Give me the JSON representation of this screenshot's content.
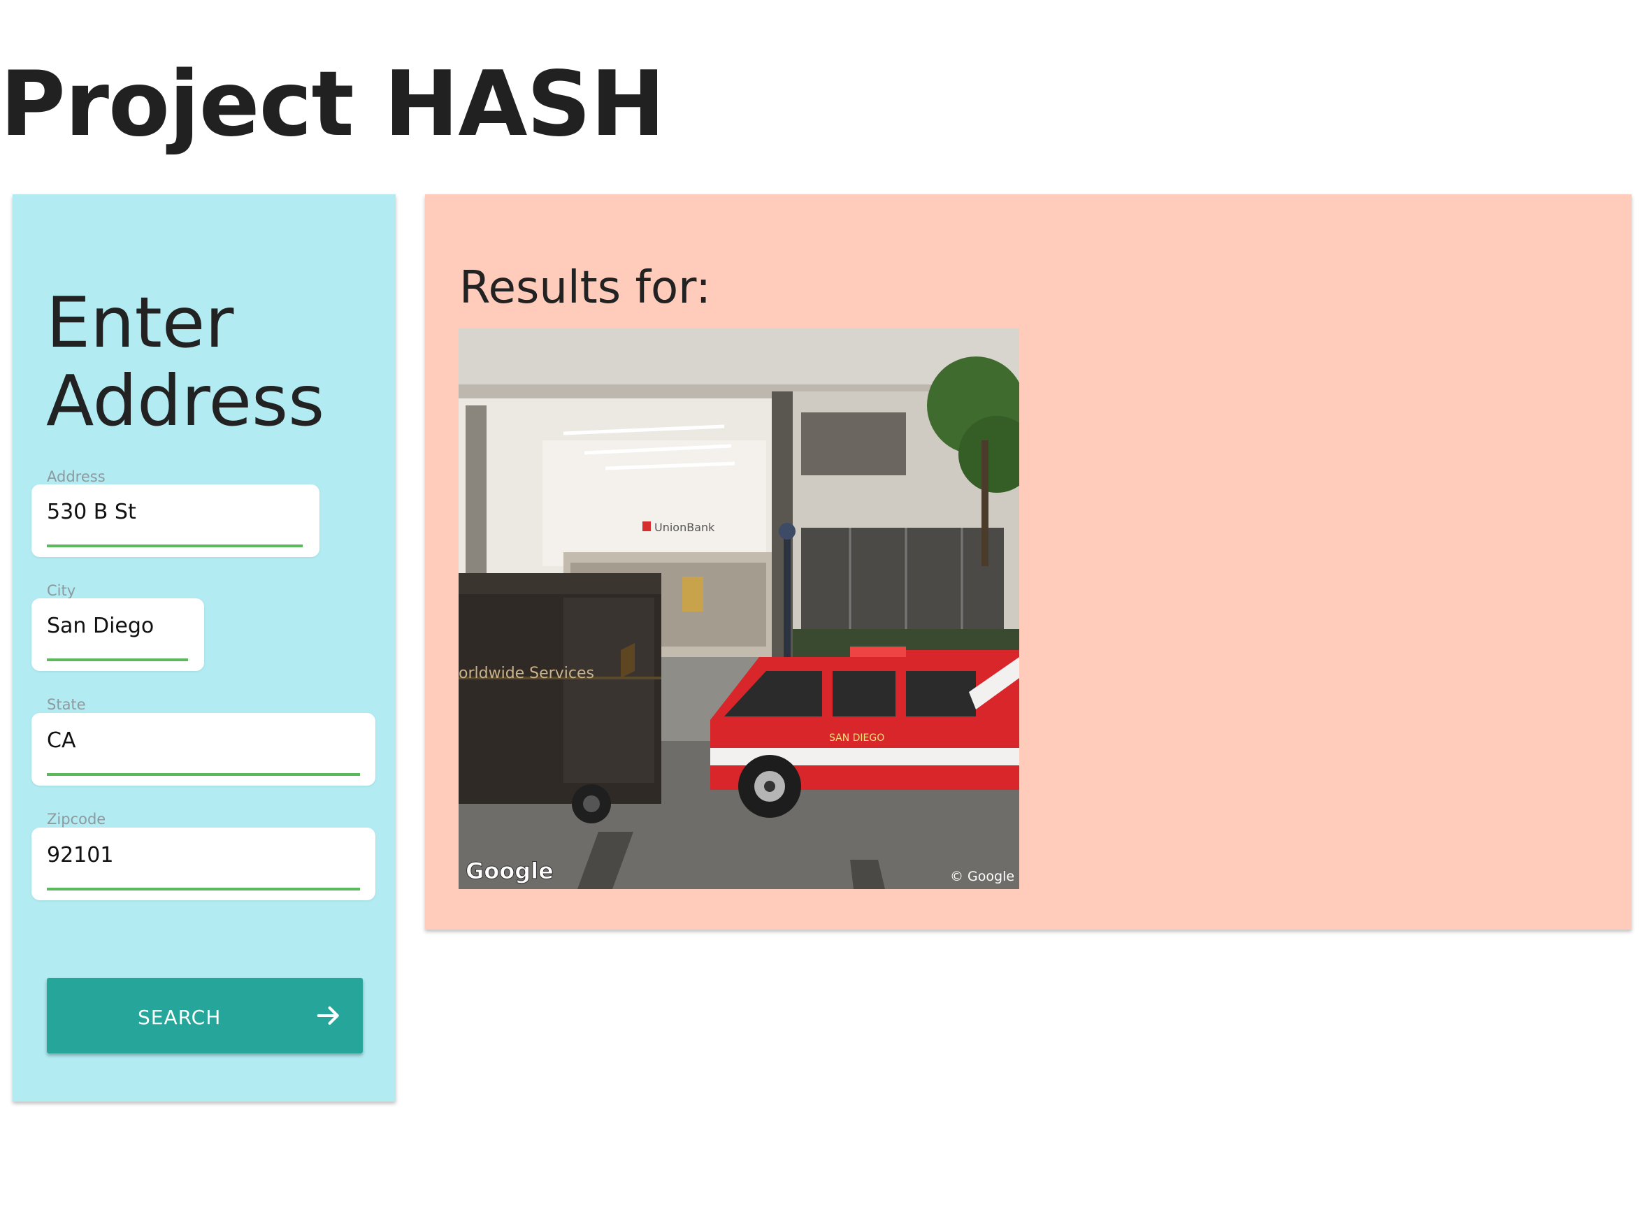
{
  "header": {
    "title": "Project HASH"
  },
  "form": {
    "heading": "Enter Address",
    "fields": [
      {
        "label": "Address",
        "value": "530 B St"
      },
      {
        "label": "City",
        "value": "San Diego"
      },
      {
        "label": "State",
        "value": "CA"
      },
      {
        "label": "Zipcode",
        "value": "92101"
      }
    ],
    "search_label": "SEARCH",
    "search_icon": "arrow-right-icon"
  },
  "results": {
    "heading": "Results for:",
    "image": {
      "watermark_logo": "Google",
      "copyright": "© Google",
      "bank_sign": "UnionBank",
      "truck_text": "orldwide Services",
      "door_text": "SAN DIEGO"
    }
  },
  "colors": {
    "left_panel_bg": "#b2ebf2",
    "right_panel_bg": "#ffccbc",
    "accent": "#26a69a",
    "underline": "#5cb85c"
  }
}
